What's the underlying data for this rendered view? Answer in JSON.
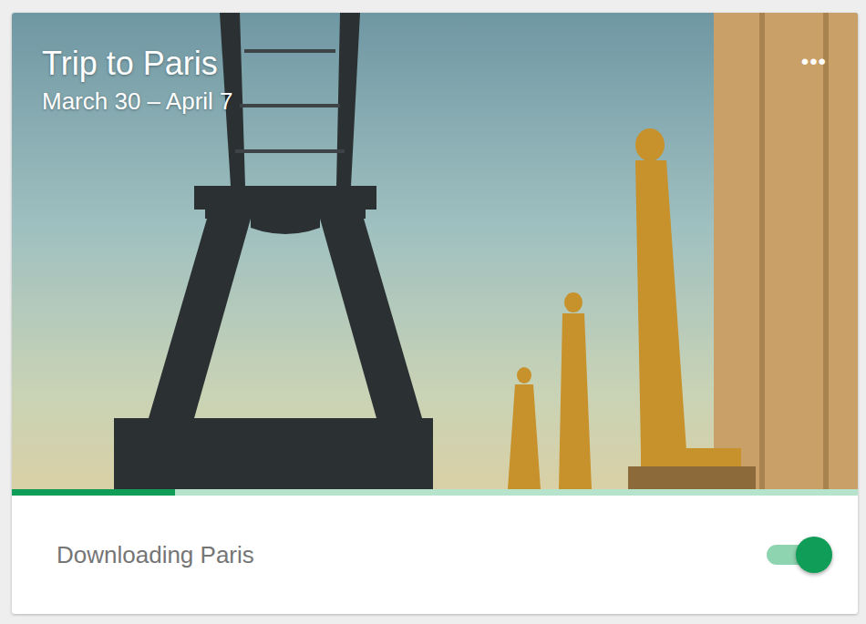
{
  "card": {
    "title": "Trip to Paris",
    "dates": "March 30 – April 7",
    "menu": "•••"
  },
  "download": {
    "level": 0.193,
    "label": "Downloading Paris",
    "on": true
  }
}
